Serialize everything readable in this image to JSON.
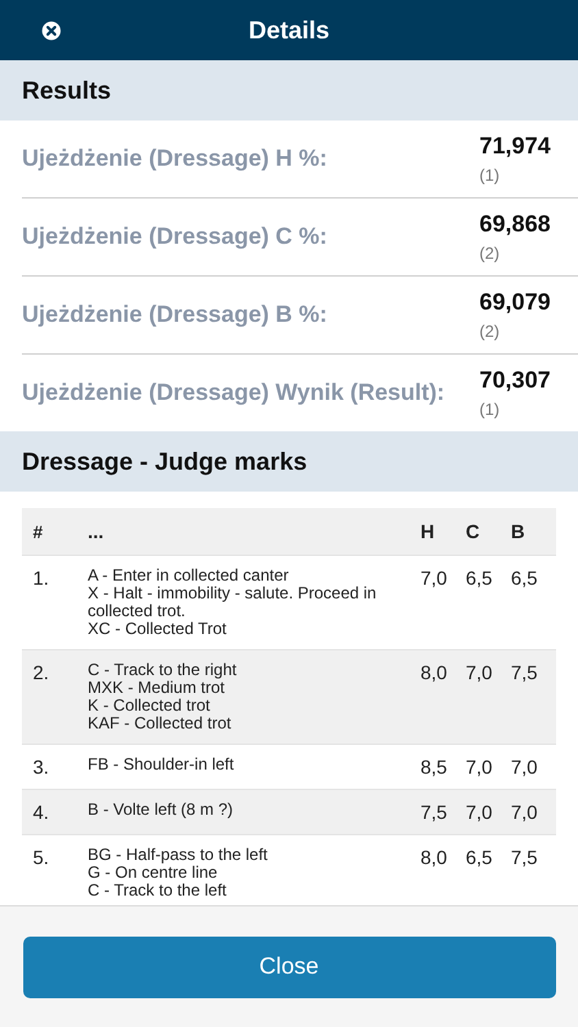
{
  "header": {
    "title": "Details"
  },
  "results": {
    "title": "Results",
    "items": [
      {
        "label": "Ujeżdżenie (Dressage) H %:",
        "value": "71,974",
        "rank": "(1)"
      },
      {
        "label": "Ujeżdżenie (Dressage) C %:",
        "value": "69,868",
        "rank": "(2)"
      },
      {
        "label": "Ujeżdżenie (Dressage) B %:",
        "value": "69,079",
        "rank": "(2)"
      },
      {
        "label": "Ujeżdżenie (Dressage) Wynik (Result):",
        "value": "70,307",
        "rank": "(1)"
      }
    ]
  },
  "marks": {
    "title": "Dressage - Judge marks",
    "columns": [
      "#",
      "...",
      "H",
      "C",
      "B"
    ],
    "rows": [
      {
        "number": "1.",
        "lines": [
          "A - Enter in collected canter",
          "X - Halt - immobility - salute. Proceed in collected trot.",
          "XC - Collected Trot"
        ],
        "scores": [
          "7,0",
          "6,5",
          "6,5"
        ]
      },
      {
        "number": "2.",
        "lines": [
          "C - Track to the right",
          "MXK - Medium trot",
          "K - Collected trot",
          "KAF - Collected trot"
        ],
        "scores": [
          "8,0",
          "7,0",
          "7,5"
        ]
      },
      {
        "number": "3.",
        "lines": [
          "FB - Shoulder-in left"
        ],
        "scores": [
          "8,5",
          "7,0",
          "7,0"
        ]
      },
      {
        "number": "4.",
        "lines": [
          "B - Volte left (8 m ?)"
        ],
        "scores": [
          "7,5",
          "7,0",
          "7,0"
        ]
      },
      {
        "number": "5.",
        "lines": [
          "BG - Half-pass to the left",
          "G - On centre line",
          "C - Track to the left"
        ],
        "scores": [
          "8,0",
          "6,5",
          "7,5"
        ]
      }
    ]
  },
  "footer": {
    "button": "Close"
  }
}
